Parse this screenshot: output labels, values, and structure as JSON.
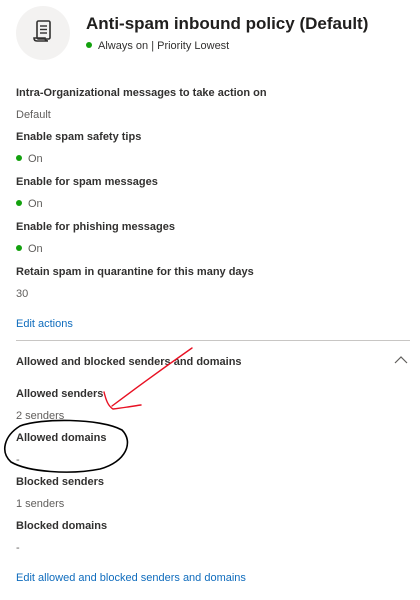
{
  "header": {
    "title": "Anti-spam inbound policy (Default)",
    "status": "Always on | Priority Lowest"
  },
  "fields": [
    {
      "label": "Intra-Organizational messages to take action on",
      "value": "Default"
    },
    {
      "label": "Enable spam safety tips",
      "value": "On"
    },
    {
      "label": "Enable for spam messages",
      "value": "On"
    },
    {
      "label": "Enable for phishing messages",
      "value": "On"
    },
    {
      "label": "Retain spam in quarantine for this many days",
      "value": "30"
    }
  ],
  "edit_actions_label": "Edit actions",
  "section": {
    "title": "Allowed and blocked senders and domains",
    "items": [
      {
        "label": "Allowed senders",
        "value": "2 senders"
      },
      {
        "label": "Allowed domains",
        "value": "-"
      },
      {
        "label": "Blocked senders",
        "value": "1 senders"
      },
      {
        "label": "Blocked domains",
        "value": "-"
      }
    ],
    "edit_label": "Edit allowed and blocked senders and domains"
  },
  "colors": {
    "status_on": "#13a10e",
    "link": "#0f6cbd",
    "annotation_red": "#e81123",
    "annotation_black": "#000000"
  },
  "icons": {
    "policy": "scroll-icon",
    "collapse": "chevron-up-icon"
  }
}
